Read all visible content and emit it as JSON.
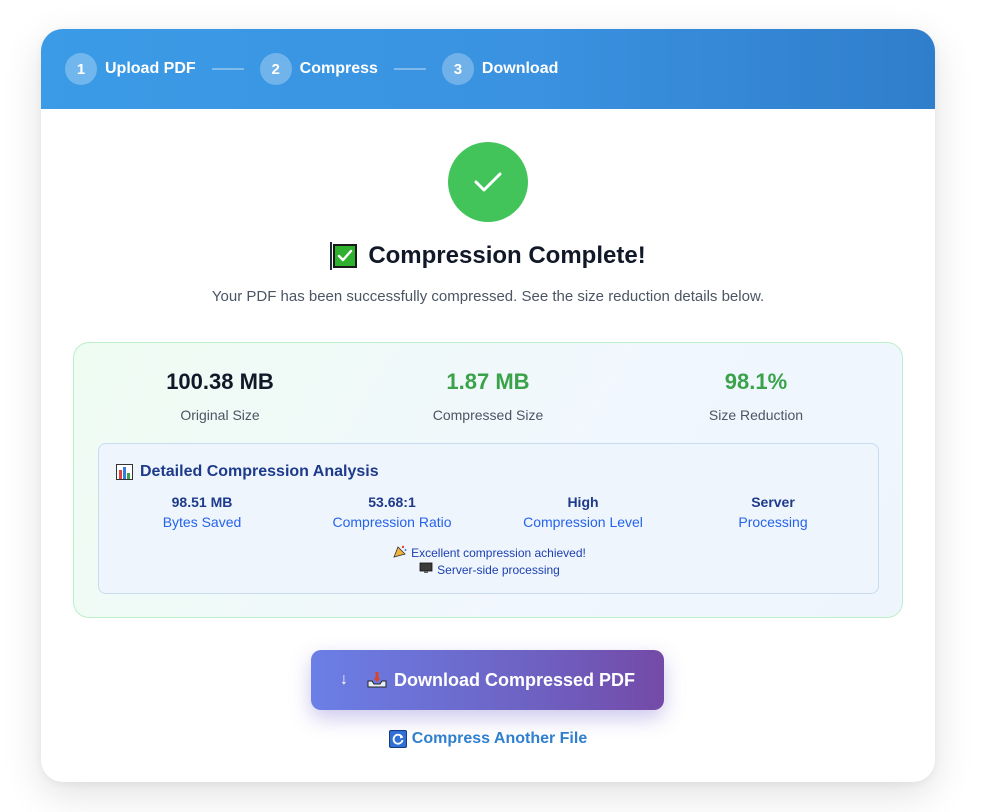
{
  "steps": [
    {
      "number": "1",
      "label": "Upload PDF"
    },
    {
      "number": "2",
      "label": "Compress"
    },
    {
      "number": "3",
      "label": "Download"
    }
  ],
  "status": {
    "icon": "check-icon",
    "title": "Compression Complete!",
    "subtitle": "Your PDF has been successfully compressed. See the size reduction details below."
  },
  "stats": [
    {
      "value": "100.38 MB",
      "label": "Original Size",
      "color": "#111827"
    },
    {
      "value": "1.87 MB",
      "label": "Compressed Size",
      "color": "#3aa34a"
    },
    {
      "value": "98.1%",
      "label": "Size Reduction",
      "color": "#3aa34a"
    }
  ],
  "analysis": {
    "title": "Detailed Compression Analysis",
    "metrics": [
      {
        "value": "98.51 MB",
        "label": "Bytes Saved"
      },
      {
        "value": "53.68:1",
        "label": "Compression Ratio"
      },
      {
        "value": "High",
        "label": "Compression Level"
      },
      {
        "value": "Server",
        "label": "Processing"
      }
    ],
    "notes": [
      {
        "icon": "party-popper-icon",
        "text": "Excellent compression achieved!"
      },
      {
        "icon": "monitor-icon",
        "text": "Server-side processing"
      }
    ]
  },
  "actions": {
    "download_label": "Download Compressed PDF",
    "another_label": "Compress Another File"
  },
  "colors": {
    "header_gradient_start": "#3b9be6",
    "header_gradient_end": "#2f7ecb",
    "success_green": "#43c45a",
    "button_gradient_start": "#6b7fe6",
    "button_gradient_end": "#744aa7",
    "link_blue": "#2f7fcf"
  }
}
